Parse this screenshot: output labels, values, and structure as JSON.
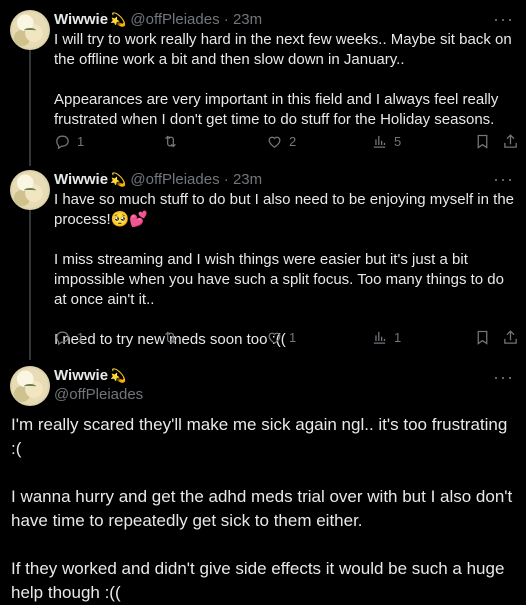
{
  "colors": {
    "background": "#000000",
    "text": "#e7e9ea",
    "muted": "#71767b",
    "line": "#333639"
  },
  "tweets": [
    {
      "name": "Wiwwie",
      "name_emoji": "💫",
      "handle": "@offPleiades",
      "separator": "·",
      "time": "23m",
      "more_icon": "more-dots-icon",
      "text": {
        "p1": "I will try to work really hard in the next few weeks.. Maybe sit back on the offline work a bit and then slow down in January..",
        "p2": "Appearances are very important in this field and I always feel really frustrated when I don't get time to do stuff for the Holiday seasons."
      },
      "actions": {
        "replies": "1",
        "retweets": "",
        "likes": "2",
        "views": "5"
      }
    },
    {
      "name": "Wiwwie",
      "name_emoji": "💫",
      "handle": "@offPleiades",
      "separator": "·",
      "time": "23m",
      "more_icon": "more-dots-icon",
      "text": {
        "p1": "I have so much stuff to do but I also need to be enjoying myself in the process!🥺💕",
        "p2": "I miss streaming and I wish things were easier but it's just a bit impossible when you have such a split focus. Too many things to do at once ain't it..",
        "p3": "I need to try new meds soon too :(("
      },
      "actions": {
        "replies": "1",
        "retweets": "",
        "likes": "1",
        "views": "1"
      }
    }
  ],
  "main_tweet": {
    "name": "Wiwwie",
    "name_emoji": "💫",
    "handle": "@offPleiades",
    "more_icon": "more-dots-icon",
    "text": {
      "p1": "I'm really scared they'll make me sick again ngl.. it's too frustrating :(",
      "p2": "I wanna hurry and get the adhd meds trial over with but I also don't have time to repeatedly get sick to them either.",
      "p3": "If they worked and didn't give side effects it would be such a huge help though :(("
    }
  }
}
